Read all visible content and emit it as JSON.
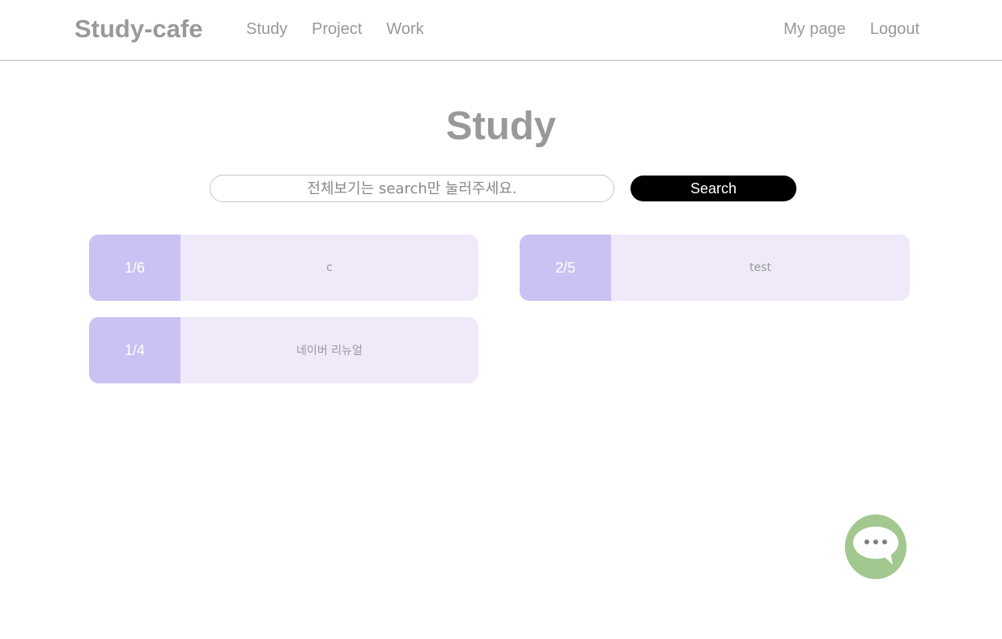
{
  "header": {
    "brand": "Study-cafe",
    "nav_left": [
      "Study",
      "Project",
      "Work"
    ],
    "nav_right": [
      "My page",
      "Logout"
    ]
  },
  "main": {
    "title": "Study",
    "search": {
      "placeholder": "전체보기는 search만 눌러주세요.",
      "value": "",
      "button_label": "Search"
    },
    "cards": [
      {
        "count": "1/6",
        "title": "c"
      },
      {
        "count": "2/5",
        "title": "test"
      },
      {
        "count": "1/4",
        "title": "네이버 리뉴얼"
      }
    ]
  },
  "chat": {
    "icon": "chat-bubble-icon"
  },
  "colors": {
    "text": "#999999",
    "card_bg": "#f0e9fa",
    "card_count_bg": "#c9c3f4",
    "search_button_bg": "#000000",
    "chat_bg": "#a2c78f"
  }
}
